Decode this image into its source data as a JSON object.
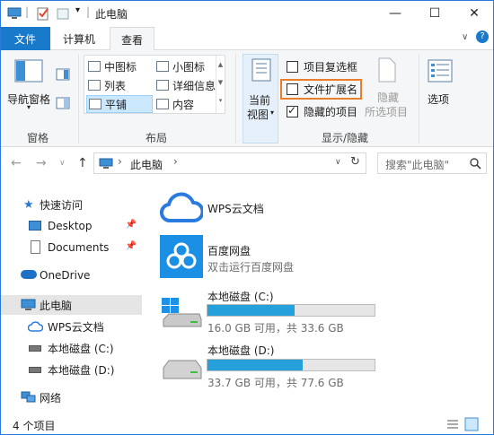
{
  "window": {
    "title": "此电脑",
    "minimize": "—",
    "maximize": "☐",
    "close": "✕"
  },
  "tabs": {
    "file": "文件",
    "computer": "计算机",
    "view": "查看"
  },
  "ribbon": {
    "pane_group": {
      "nav_pane": "导航窗格",
      "label": "窗格"
    },
    "layout_group": {
      "items": [
        "中图标",
        "小图标",
        "列表",
        "详细信息",
        "平铺",
        "内容"
      ],
      "selected": "平铺",
      "label": "布局"
    },
    "current_view": {
      "line1": "当前",
      "line2": "视图"
    },
    "show_hide": {
      "item_checkboxes": "项目复选框",
      "file_extensions": "文件扩展名",
      "hidden_items": "隐藏的项目",
      "hide_selected_1": "隐藏",
      "hide_selected_2": "所选项目",
      "options": "选项",
      "label": "显示/隐藏",
      "item_checkboxes_checked": false,
      "file_extensions_checked": false,
      "hidden_items_checked": true
    }
  },
  "address": {
    "path": "此电脑",
    "search_placeholder": "搜索\"此电脑\""
  },
  "nav": {
    "quick_access": "快速访问",
    "desktop": "Desktop",
    "documents": "Documents",
    "onedrive": "OneDrive",
    "this_pc": "此电脑",
    "wps": "WPS云文档",
    "drive_c": "本地磁盘 (C:)",
    "drive_d": "本地磁盘 (D:)",
    "network": "网络"
  },
  "content": {
    "wps": {
      "title": "WPS云文档"
    },
    "baidu": {
      "title": "百度网盘",
      "subtitle": "双击运行百度网盘"
    },
    "drive_c": {
      "title": "本地磁盘 (C:)",
      "usage": "16.0 GB 可用，共 33.6 GB",
      "used_fraction": 0.52
    },
    "drive_d": {
      "title": "本地磁盘 (D:)",
      "usage": "33.7 GB 可用，共 77.6 GB",
      "used_fraction": 0.57
    }
  },
  "status": {
    "count": "4 个项目"
  },
  "colors": {
    "accent": "#1979ca",
    "highlight": "#e97e2c",
    "bar": "#26a0da"
  }
}
